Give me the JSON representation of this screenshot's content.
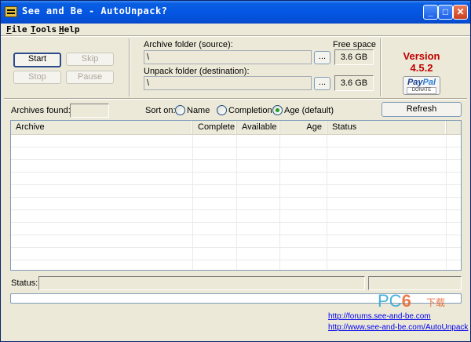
{
  "window": {
    "title": "See and Be - AutoUnpack?"
  },
  "menu": {
    "items": [
      "File",
      "Tools",
      "Help"
    ]
  },
  "buttons": {
    "start": "Start",
    "skip": "Skip",
    "stop": "Stop",
    "pause": "Pause",
    "refresh": "Refresh",
    "browse": "..."
  },
  "archive_folder": {
    "label": "Archive folder (source):",
    "value": "\\",
    "free_space": "3.6 GB"
  },
  "unpack_folder": {
    "label": "Unpack folder (destination):",
    "value": "\\",
    "free_space": "3.6 GB"
  },
  "free_space_label": "Free space",
  "version": {
    "line1": "Version",
    "line2": "4.5.2"
  },
  "paypal": {
    "brand_pay": "Pay",
    "brand_pal": "Pal",
    "donate": "DONATE"
  },
  "archives_found": {
    "label": "Archives found:",
    "value": ""
  },
  "sort": {
    "label": "Sort on:",
    "options": [
      {
        "label": "Name",
        "checked": false
      },
      {
        "label": "Completion",
        "checked": false
      },
      {
        "label": "Age (default)",
        "checked": true
      }
    ]
  },
  "table": {
    "columns": [
      "Archive",
      "Complete",
      "Available",
      "Age",
      "Status"
    ],
    "rows": []
  },
  "status": {
    "label": "Status:",
    "value": "",
    "secondary": ""
  },
  "progress": 0,
  "links": [
    "http://forums.see-and-be.com",
    "http://www.see-and-be.com/AutoUnpack"
  ],
  "watermark": {
    "pc": "PC",
    "six": "6",
    "cn": "下载"
  },
  "colors": {
    "title_bar": "#0456e3",
    "version_text": "#c00000",
    "link": "#0000ee",
    "window_bg": "#ece9d8"
  }
}
